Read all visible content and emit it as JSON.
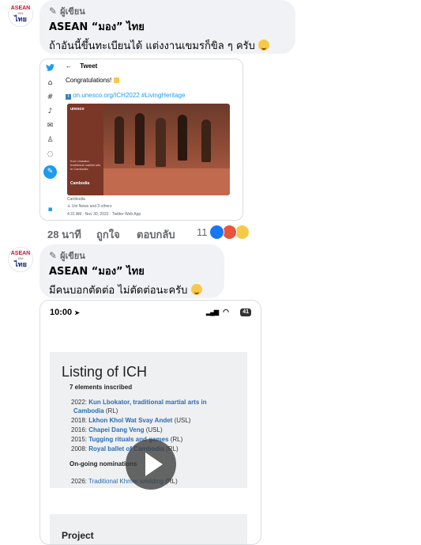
{
  "comments": [
    {
      "avatar": {
        "line1": "ASEAN",
        "line2": "มอง",
        "line3": "ไทย"
      },
      "badge": "ผู้เขียน",
      "author": "ASEAN “มอง” ไทย",
      "text": "ถ้าอันนี้ขึ้นทะเบียนได้ แต่งงานเขมรก็ขิล ๆ ครับ"
    },
    {
      "avatar": {
        "line1": "ASEAN",
        "line2": "มอง",
        "line3": "ไทย"
      },
      "badge": "ผู้เขียน",
      "author": "ASEAN “มอง” ไทย",
      "text": "มีคนบอกตัดต่อ ไม่ตัดต่อนะครับ"
    }
  ],
  "tweet": {
    "header": "Tweet",
    "congrats": "Congratulations!",
    "link": "on.unesco.org/ICH2022 #LivingHeritage",
    "photo_brand": "unesco",
    "photo_caption": "Kun Lbokator, traditional martial arts in Cambodia",
    "photo_country": "Cambodia",
    "photo_link": "Cambodia",
    "attribution": "Uni News and 3 others",
    "meta": "4:31 AM · Nov 30, 2022 · Twitter Web App"
  },
  "comment_actions": {
    "time": "28 นาที",
    "like": "ถูกใจ",
    "reply": "ตอบกลับ",
    "reaction_count": "11"
  },
  "phone": {
    "time": "10:00",
    "battery": "41",
    "title": "Listing of ICH",
    "count": "7 elements inscribed",
    "items": [
      {
        "year": "2022:",
        "name": "Kun Lbokator, traditional martial arts in",
        "tail": ""
      },
      {
        "year": "",
        "name": "Cambodia",
        "tail": " (RL)"
      },
      {
        "year": "2018:",
        "name": "Lkhon Khol Wat Svay Andet",
        "tail": " (USL)"
      },
      {
        "year": "2016:",
        "name": "Chapei Dang Veng",
        "tail": " (USL)"
      },
      {
        "year": "2015:",
        "name": "Tugging rituals and games",
        "tail": " (RL)"
      },
      {
        "year": "2008:",
        "name": "Royal ballet of Cambodia",
        "tail": " (RL)"
      }
    ],
    "ongoing": "On-going nominations",
    "ongoing_item": {
      "year": "2026:",
      "name": "Traditional Khmer wedding",
      "tail": " (RL)"
    },
    "next_section": "Project"
  }
}
